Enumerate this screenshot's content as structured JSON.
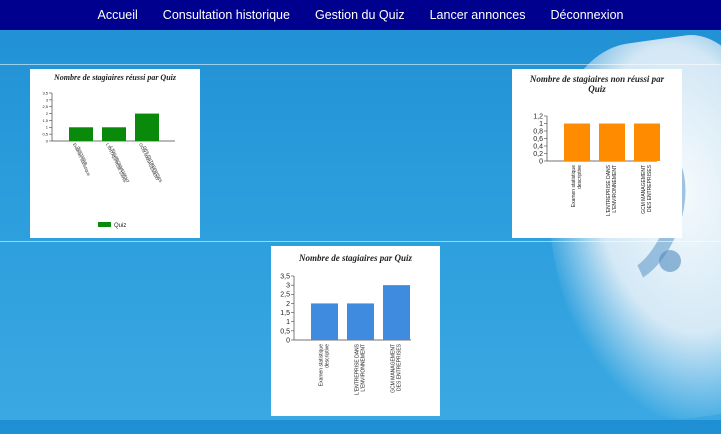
{
  "nav": {
    "items": [
      "Accueil",
      "Consultation historique",
      "Gestion du Quiz",
      "Lancer annonces",
      "Déconnexion"
    ]
  },
  "chart_data": [
    {
      "type": "bar",
      "title": "Nombre de stagiaires réussi par Quiz",
      "categories": [
        "Examen statistique descriptive",
        "L'ENTREPRISE DANS L'ENVIRONNEMENT",
        "GCM MANAGEMENT DES ENTREPRISES"
      ],
      "series": [
        {
          "name": "Quiz",
          "values": [
            1,
            1,
            2
          ]
        }
      ],
      "ylim": [
        0,
        3.5
      ],
      "yticks": [
        "3,5",
        "3",
        "2,5",
        "2",
        "1,5",
        "1",
        "0,5",
        "0"
      ],
      "color": "#0a8a0a",
      "legend": "bottom"
    },
    {
      "type": "bar",
      "title": "Nombre de stagiaires non réussi par Quiz",
      "categories": [
        "Examen statistique descriptive",
        "L'ENTREPRISE DANS L'ENVIRONNEMENT",
        "GCM MANAGEMENT DES ENTREPRISES"
      ],
      "series": [
        {
          "values": [
            1,
            1,
            1
          ]
        }
      ],
      "ylim": [
        0,
        1.2
      ],
      "yticks": [
        "1,2",
        "1",
        "0,8",
        "0,6",
        "0,4",
        "0,2",
        "0"
      ],
      "color": "#ff8c00"
    },
    {
      "type": "bar",
      "title": "Nombre de stagiaires par Quiz",
      "categories": [
        "Examen statistique descriptive",
        "L'ENTREPRISE DANS L'ENVIRONNEMENT",
        "GCM MANAGEMENT DES ENTREPRISES"
      ],
      "series": [
        {
          "values": [
            2,
            2,
            3
          ]
        }
      ],
      "ylim": [
        0,
        3.5
      ],
      "yticks": [
        "3,5",
        "3",
        "2,5",
        "2",
        "1,5",
        "1",
        "0,5",
        "0"
      ],
      "color": "#3f8be0"
    }
  ]
}
